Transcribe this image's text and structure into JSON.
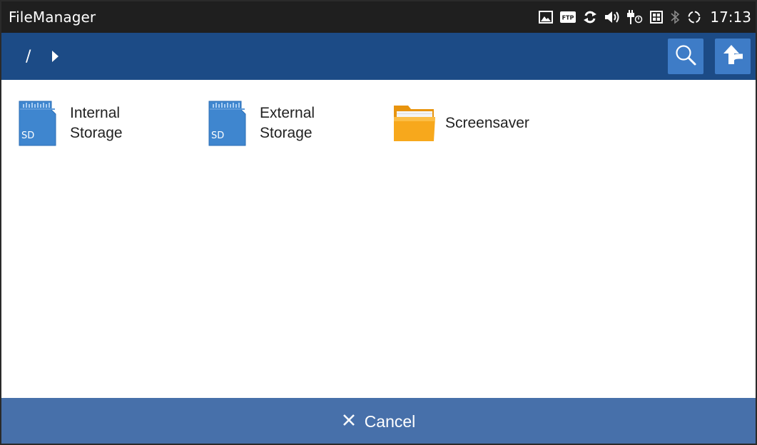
{
  "statusbar": {
    "app_title": "FileManager",
    "time": "17:13",
    "icons": [
      "image-icon",
      "ftp-icon",
      "sync-icon",
      "volume-icon",
      "usb-icon",
      "sim-icon",
      "bluetooth-icon",
      "loading-icon"
    ],
    "ftp_label": "FTP"
  },
  "toolbar": {
    "path_root": "/",
    "buttons": [
      "search-icon",
      "up-directory-icon"
    ]
  },
  "files": [
    {
      "label_line1": "Internal",
      "label_line2": "Storage",
      "icon": "sd-card-icon",
      "icon_text": "SD"
    },
    {
      "label_line1": "External",
      "label_line2": "Storage",
      "icon": "sd-card-icon",
      "icon_text": "SD"
    },
    {
      "label_line1": "Screensaver",
      "label_line2": "",
      "icon": "folder-icon"
    }
  ],
  "footer": {
    "cancel_label": "Cancel"
  },
  "colors": {
    "statusbar_bg": "#1f1f1f",
    "toolbar_bg": "#1c4b86",
    "toolbar_button_bg": "#3e7cc7",
    "cancel_bar_bg": "#4770aa",
    "sd_card": "#3f86cf",
    "folder": "#f7a81c"
  }
}
